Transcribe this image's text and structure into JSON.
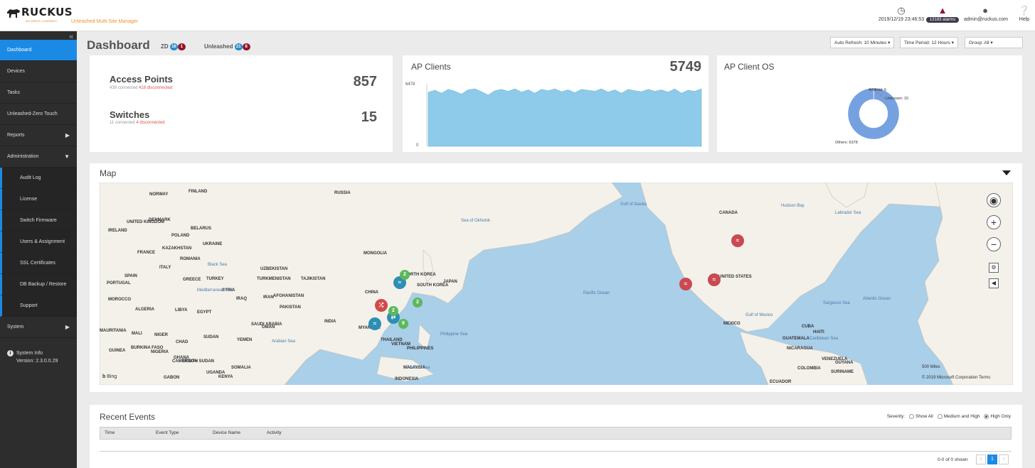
{
  "header": {
    "brand": "RUCKUS",
    "brand_tag": "AN ARRIS COMPANY",
    "subtitle": "Unleashed Multi-Site Manager",
    "datetime": "2019/12/19 23:46:53",
    "alarms": "13183 alarms",
    "user": "admin@ruckus.com",
    "help": "Help"
  },
  "sidebar": {
    "items": [
      {
        "label": "Dashboard",
        "active": true
      },
      {
        "label": "Devices"
      },
      {
        "label": "Tasks"
      },
      {
        "label": "Unleashed-Zero Touch"
      },
      {
        "label": "Reports",
        "caret": "▶"
      },
      {
        "label": "Administration",
        "caret": "▼"
      },
      {
        "label": "Audit Log",
        "sub": true
      },
      {
        "label": "License",
        "sub": true
      },
      {
        "label": "Switch Firmware",
        "sub": true
      },
      {
        "label": "Users & Assignment",
        "sub": true
      },
      {
        "label": "SSL Certificates",
        "sub": true
      },
      {
        "label": "DB Backup / Restore",
        "sub": true
      },
      {
        "label": "Support",
        "sub": true
      },
      {
        "label": "System",
        "caret": "▶"
      }
    ],
    "system_info_label": "System Info",
    "version": "Version: 2.3.0.0.29"
  },
  "dashboard": {
    "title": "Dashboard",
    "zd_label": "ZD",
    "zd_count_a": "16",
    "zd_count_b": "1",
    "unleashed_label": "Unleashed",
    "unleashed_count_a": "21",
    "unleashed_count_b": "8",
    "auto_refresh": "Auto Refresh: 10 Minutes ▾",
    "time_period": "Time Period: 12 Hours ▾",
    "group": "Group: All ▾"
  },
  "access_points": {
    "label": "Access Points",
    "connected": "439 connected",
    "disconnected": "418 disconnected",
    "total": "857"
  },
  "switches": {
    "label": "Switches",
    "connected": "11 connected",
    "disconnected": "4 disconnected",
    "total": "15"
  },
  "ap_clients": {
    "title": "AP Clients",
    "total": "5749",
    "ymax_label": "6478",
    "ymin_label": "0"
  },
  "client_os": {
    "title": "AP Client OS",
    "labels": {
      "android": "Android: 6",
      "unknown": "Unknown: 15",
      "others": "Others: 6378"
    }
  },
  "chart_data": [
    {
      "type": "area",
      "title": "AP Clients",
      "ylim": [
        0,
        6478
      ],
      "values": [
        5600,
        5800,
        5500,
        5900,
        5700,
        5400,
        5850,
        5950,
        5650,
        5300,
        5750,
        5900,
        5700,
        5950,
        5600,
        5850,
        5500,
        5900,
        5750,
        5950,
        5650,
        5850,
        5550,
        5900,
        5800,
        5700,
        5950,
        5600,
        5850,
        5500,
        5900,
        5750,
        5650,
        5900,
        5700,
        5850,
        5600,
        5950,
        5500,
        5800,
        5700,
        5950
      ]
    },
    {
      "type": "pie",
      "title": "AP Client OS",
      "donut": true,
      "categories": [
        "Android",
        "Unknown",
        "Others"
      ],
      "values": [
        6,
        15,
        6378
      ],
      "color": "#76a1e0"
    }
  ],
  "map": {
    "title": "Map",
    "bing": "Bing",
    "scale": "500 Miles",
    "copyright": "© 2019 Microsoft Corporation Terms",
    "labels": [
      {
        "t": "RUSSIA"
      },
      {
        "t": "CHINA"
      },
      {
        "t": "MONGOLIA"
      },
      {
        "t": "KAZAKHSTAN"
      },
      {
        "t": "CANADA"
      },
      {
        "t": "UNITED STATES"
      },
      {
        "t": "MEXICO"
      },
      {
        "t": "INDIA"
      },
      {
        "t": "NORTH KOREA"
      },
      {
        "t": "SOUTH KOREA"
      },
      {
        "t": "JAPAN"
      },
      {
        "t": "THAILAND"
      },
      {
        "t": "PHILIPPINES"
      },
      {
        "t": "VIETNAM"
      },
      {
        "t": "MALAYSIA"
      },
      {
        "t": "INDONESIA"
      },
      {
        "t": "IRAN"
      },
      {
        "t": "IRAQ"
      },
      {
        "t": "SYRIA"
      },
      {
        "t": "TURKEY"
      },
      {
        "t": "EGYPT"
      },
      {
        "t": "LIBYA"
      },
      {
        "t": "ALGERIA"
      },
      {
        "t": "MOROCCO"
      },
      {
        "t": "SPAIN"
      },
      {
        "t": "FRANCE"
      },
      {
        "t": "POLAND"
      },
      {
        "t": "UKRAINE"
      },
      {
        "t": "NORWAY"
      },
      {
        "t": "FINLAND"
      },
      {
        "t": "SAUDI ARABIA"
      },
      {
        "t": "PAKISTAN"
      },
      {
        "t": "AFGHANISTAN"
      },
      {
        "t": "UZBEKISTAN"
      },
      {
        "t": "TURKMENISTAN"
      },
      {
        "t": "SUDAN"
      },
      {
        "t": "CHAD"
      },
      {
        "t": "NIGER"
      },
      {
        "t": "MALI"
      },
      {
        "t": "MAURITANIA"
      },
      {
        "t": "NIGERIA"
      },
      {
        "t": "YEMEN"
      },
      {
        "t": "OMAN"
      },
      {
        "t": "MYANMAR"
      },
      {
        "t": "UNITED KINGDOM"
      },
      {
        "t": "IRELAND"
      },
      {
        "t": "DENMARK"
      },
      {
        "t": "BELARUS"
      },
      {
        "t": "ROMANIA"
      },
      {
        "t": "ITALY"
      },
      {
        "t": "GREECE"
      },
      {
        "t": "PORTUGAL"
      },
      {
        "t": "CUBA"
      },
      {
        "t": "HAITI"
      },
      {
        "t": "GUATEMALA"
      },
      {
        "t": "NICARAGUA"
      },
      {
        "t": "VENEZUELA"
      },
      {
        "t": "COLOMBIA"
      },
      {
        "t": "GUYANA"
      },
      {
        "t": "SURINAME"
      },
      {
        "t": "ECUADOR"
      },
      {
        "t": "SOMALIA"
      },
      {
        "t": "KENYA"
      },
      {
        "t": "UGANDA"
      },
      {
        "t": "CAMEROON"
      },
      {
        "t": "GABON"
      },
      {
        "t": "SOUTH SUDAN"
      },
      {
        "t": "GUINEA"
      },
      {
        "t": "BURKINA FASO"
      },
      {
        "t": "GHANA"
      },
      {
        "t": "TAJIKISTAN"
      }
    ],
    "seas": [
      {
        "t": "Pacific Ocean"
      },
      {
        "t": "Atlantic Ocean"
      },
      {
        "t": "Gulf of Alaska"
      },
      {
        "t": "Hudson Bay"
      },
      {
        "t": "Sea of Okhotsk"
      },
      {
        "t": "Philippine Sea"
      },
      {
        "t": "Arabian Sea"
      },
      {
        "t": "Gulf of Mexico"
      },
      {
        "t": "Caribbean Sea"
      },
      {
        "t": "Sargasso Sea"
      },
      {
        "t": "Mediterranean Sea"
      },
      {
        "t": "Black Sea"
      },
      {
        "t": "Labrador Sea"
      },
      {
        "t": "Celebes Sea"
      }
    ],
    "clusters": [
      "2",
      "2",
      "2",
      "9"
    ]
  },
  "events": {
    "title": "Recent Events",
    "severity_label": "Severity:",
    "show_all": "Show All",
    "medium_high": "Medium and High",
    "high_only": "High Only",
    "columns": [
      "Time",
      "Event Type",
      "Device Name",
      "Activity"
    ],
    "shown": "0-0 of 0 shown",
    "page": "1",
    "prev": "‹",
    "next": "›"
  }
}
